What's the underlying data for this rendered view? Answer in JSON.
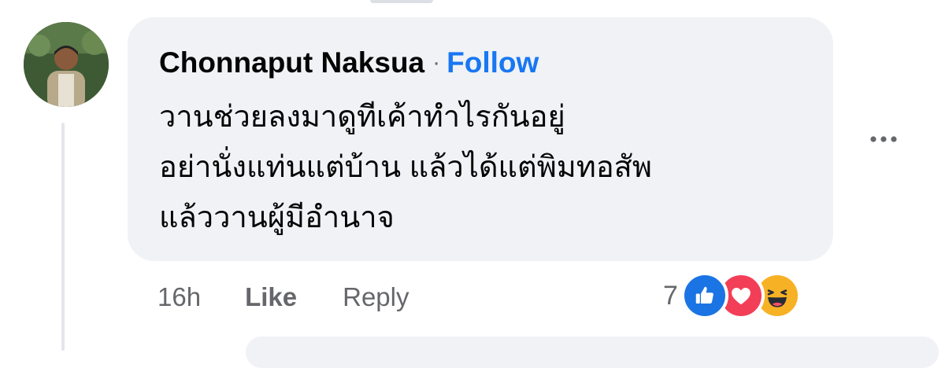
{
  "comment": {
    "author": "Chonnaput Naksua",
    "separator": "·",
    "follow_label": "Follow",
    "text_lines": [
      "วานช่วยลงมาดูทีเค้าทำไรกันอยู่",
      "อย่านั่งแท่นแต่บ้าน แล้วได้แต่พิมทอสัพ",
      "แล้ววานผู้มีอำนาจ"
    ],
    "more_label": "···"
  },
  "actions": {
    "timestamp": "16h",
    "like_label": "Like",
    "reply_label": "Reply"
  },
  "reactions": {
    "count": "7",
    "types": [
      "like",
      "love",
      "haha"
    ]
  },
  "icons": {
    "like": "thumbs-up-icon",
    "love": "heart-icon",
    "haha": "laughing-face-icon"
  },
  "colors": {
    "bubble": "#f0f2f5",
    "link": "#1877f2",
    "secondary_text": "#65676b",
    "like": "#1b74e4",
    "love": "#f33e58",
    "haha": "#f7b125"
  }
}
